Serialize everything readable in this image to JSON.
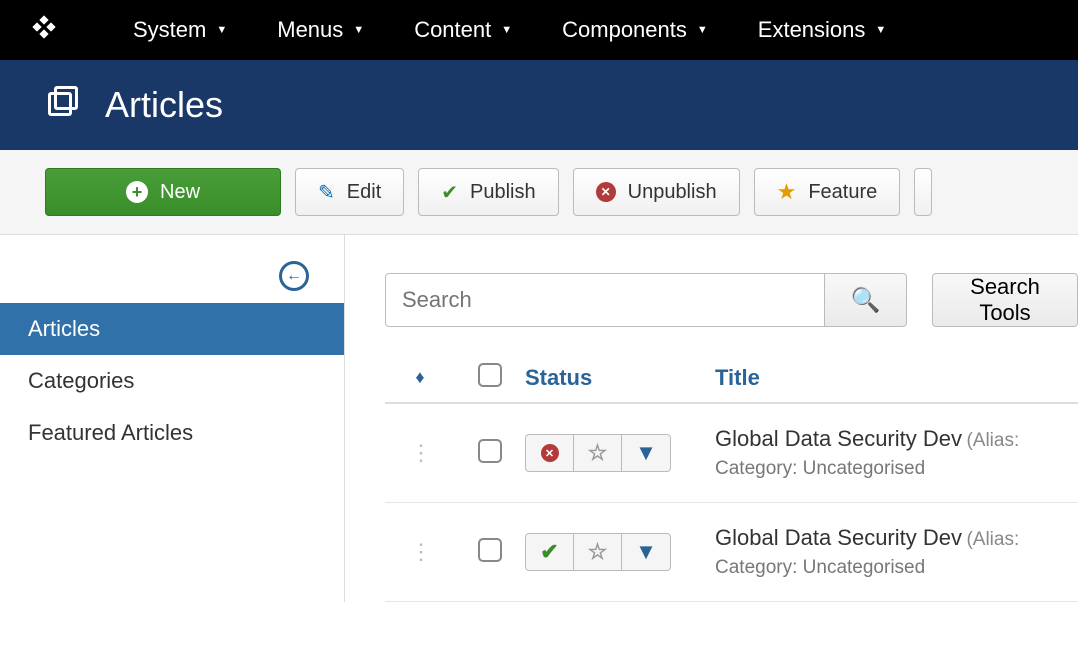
{
  "topnav": {
    "items": [
      "System",
      "Menus",
      "Content",
      "Components",
      "Extensions"
    ]
  },
  "header": {
    "title": "Articles"
  },
  "toolbar": {
    "new": "New",
    "edit": "Edit",
    "publish": "Publish",
    "unpublish": "Unpublish",
    "feature": "Feature"
  },
  "sidebar": {
    "items": [
      {
        "label": "Articles",
        "active": true
      },
      {
        "label": "Categories",
        "active": false
      },
      {
        "label": "Featured Articles",
        "active": false
      }
    ]
  },
  "search": {
    "placeholder": "Search",
    "tools_label": "Search Tools"
  },
  "table": {
    "headers": {
      "status": "Status",
      "title": "Title"
    },
    "rows": [
      {
        "status": "unpublished",
        "title": "Global Data Security Dev",
        "alias_prefix": "(Alias:",
        "category_label": "Category:",
        "category": "Uncategorised"
      },
      {
        "status": "published",
        "title": "Global Data Security Dev",
        "alias_prefix": "(Alias:",
        "category_label": "Category:",
        "category": "Uncategorised"
      }
    ]
  }
}
